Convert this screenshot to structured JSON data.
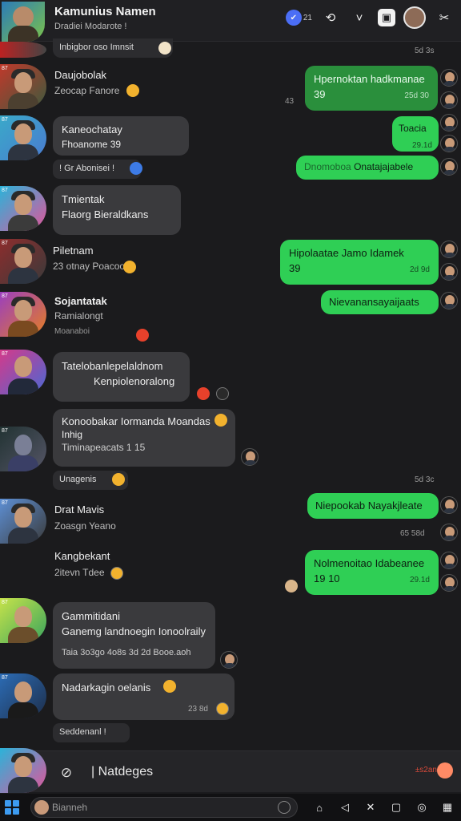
{
  "header": {
    "title": "Kamunius Namen",
    "subtitle": "Dradiei Modarote !",
    "count": "21",
    "icons": [
      "info-icon",
      "search-icon",
      "chevron-down-icon",
      "video-icon",
      "profile-avatar",
      "tools-icon"
    ]
  },
  "messages": {
    "top_preview": "Inbigbor oso Imnsit",
    "top_time": "5d 3s",
    "m1_name": "Daujobolak",
    "m1_sub": "Zeocap Fanore",
    "m1_out_text": "Hpernoktan hadkmanae",
    "m1_out_num": "39",
    "m1_out_time": "25d 30",
    "m1_side": "43",
    "m2_text1": "Kaneochatay",
    "m2_text2": "Fhoanome 39",
    "m2_out": "Toacia",
    "m2_out_time": "29.1d",
    "m2_react": "! Gr Abonisei !",
    "m2_out2_a": "Dnomoboa",
    "m2_out2_b": "Onatajajabele",
    "m3_text1": "Tmientak",
    "m3_text2": "Flaorg Bieraldkans",
    "m4_name": "Piletnam",
    "m4_sub": "23 otnay Poacoo",
    "m4_out_text": "Hipolaatae Jamo Idamek",
    "m4_out_num": "39",
    "m4_out_time": "2d 9d",
    "m5_name": "Sojantatak",
    "m5_sub": "Ramialongt",
    "m5_sub2": "Moanaboi",
    "m5_out": "Nievanansayaijaats",
    "m6_text1": "Tatelobanlepelaldnom",
    "m6_text2": "Kenpiolenoralong",
    "m7_text1": "Konoobakar Iormanda Moandas",
    "m7_text2": "Inhig",
    "m7_text3": "Timinapeacats 1 15",
    "m7_react": "Unagenis",
    "m7_time": "5d 3c",
    "m8_name": "Drat Mavis",
    "m8_sub": "Zoasgn Yeano",
    "m8_out": "Niepookab Nayakjleate",
    "m8_time": "65 58d",
    "m9_name": "Kangbekant",
    "m9_sub": "2itevn Tdee",
    "m9_out_text": "Nolmenoitao Idabeanee",
    "m9_out_num": "19 10",
    "m9_out_time": "29.1d",
    "m10_text1": "Gammitidani",
    "m10_text2": "Ganemg landnoegin Ionoolraily",
    "m10_text3": "Taia 3o3go 4o8s 3d 2d Booe.aoh",
    "m11_text": "Nadarkagin oelanis",
    "m11_time": "23 8d",
    "m11_react": "Seddenanl !"
  },
  "input": {
    "placeholder": "Natdeges",
    "send_hint": "±s2an"
  },
  "taskbar": {
    "search": "Bianneh"
  },
  "colors": {
    "outgoing": "#2fcf55",
    "incoming": "#3a3a3d",
    "background": "#1b1b1d"
  }
}
